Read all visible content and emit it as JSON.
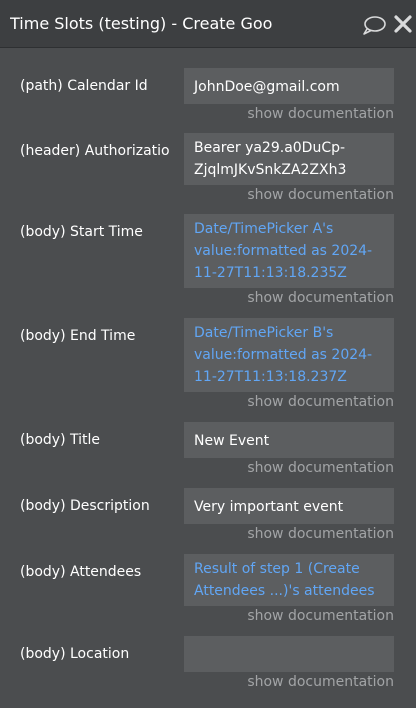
{
  "header": {
    "title": "Time Slots (testing) - Create Goo"
  },
  "fields": [
    {
      "label": "(path) Calendar Id",
      "value": "JohnDoe@gmail.com",
      "doc": "show documentation"
    },
    {
      "label": "(header) Authorizatio",
      "value": "Bearer ya29.a0DuCp-ZjqlmJKvSnkZA2ZXh3",
      "doc": "show documentation"
    },
    {
      "label": "(body) Start Time",
      "value": "Date/TimePicker A's value:formatted as 2024-11-27T11:13:18.235Z",
      "doc": "show documentation"
    },
    {
      "label": "(body) End Time",
      "value": "Date/TimePicker B's value:formatted as 2024-11-27T11:13:18.237Z",
      "doc": "show documentation"
    },
    {
      "label": "(body) Title",
      "value": "New Event",
      "doc": "show documentation"
    },
    {
      "label": "(body) Description",
      "value": "Very important event",
      "doc": "show documentation"
    },
    {
      "label": "(body) Attendees",
      "value": "Result of step 1 (Create Attendees ...)'s attendees",
      "doc": "show documentation"
    },
    {
      "label": "(body) Location",
      "value": "",
      "doc": "show documentation"
    }
  ],
  "colors": {
    "background": "#4b4d4f",
    "titlebar": "#3d3f41",
    "input": "#5c5e60",
    "dynamic_text": "#61a6f5",
    "doc_link": "#a2a4a6"
  },
  "icons": [
    "comment-icon",
    "close-icon"
  ]
}
